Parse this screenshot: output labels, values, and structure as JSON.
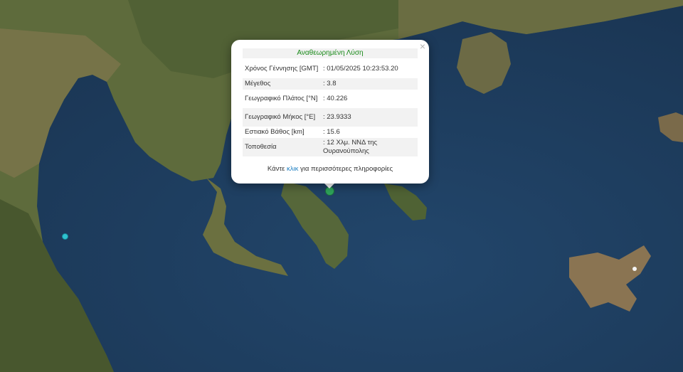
{
  "popup": {
    "close_symbol": "×",
    "title": "Αναθεωρημένη Λύση",
    "rows": [
      {
        "label": "Χρόνος Γέννησης [GMT]",
        "value": ": 01/05/2025 10:23:53.20"
      },
      {
        "label": "Μέγεθος",
        "value": ": 3.8"
      },
      {
        "label": "Γεωγραφικό Πλάτος [°N]",
        "value": ": 40.226"
      },
      {
        "label": "Γεωγραφικό Μήκος [°E]",
        "value": ": 23.9333"
      },
      {
        "label": "Εστιακό Βάθος [km]",
        "value": ": 15.6"
      },
      {
        "label": "Τοποθεσία",
        "value": ": 12 Χλμ. ΝΝΔ της Ουρανούπολης"
      }
    ],
    "more_prefix": "Κάντε",
    "more_link": "κλικ",
    "more_suffix": "για περισσότερες πληροφορίες"
  },
  "colors": {
    "sea": "#1e3a5c",
    "land": "#5f6a3a",
    "title_green": "#1a8a1a",
    "link_blue": "#1e7fc2",
    "marker_main": "#2ea35a",
    "marker_secondary": "#2ec2d0"
  }
}
